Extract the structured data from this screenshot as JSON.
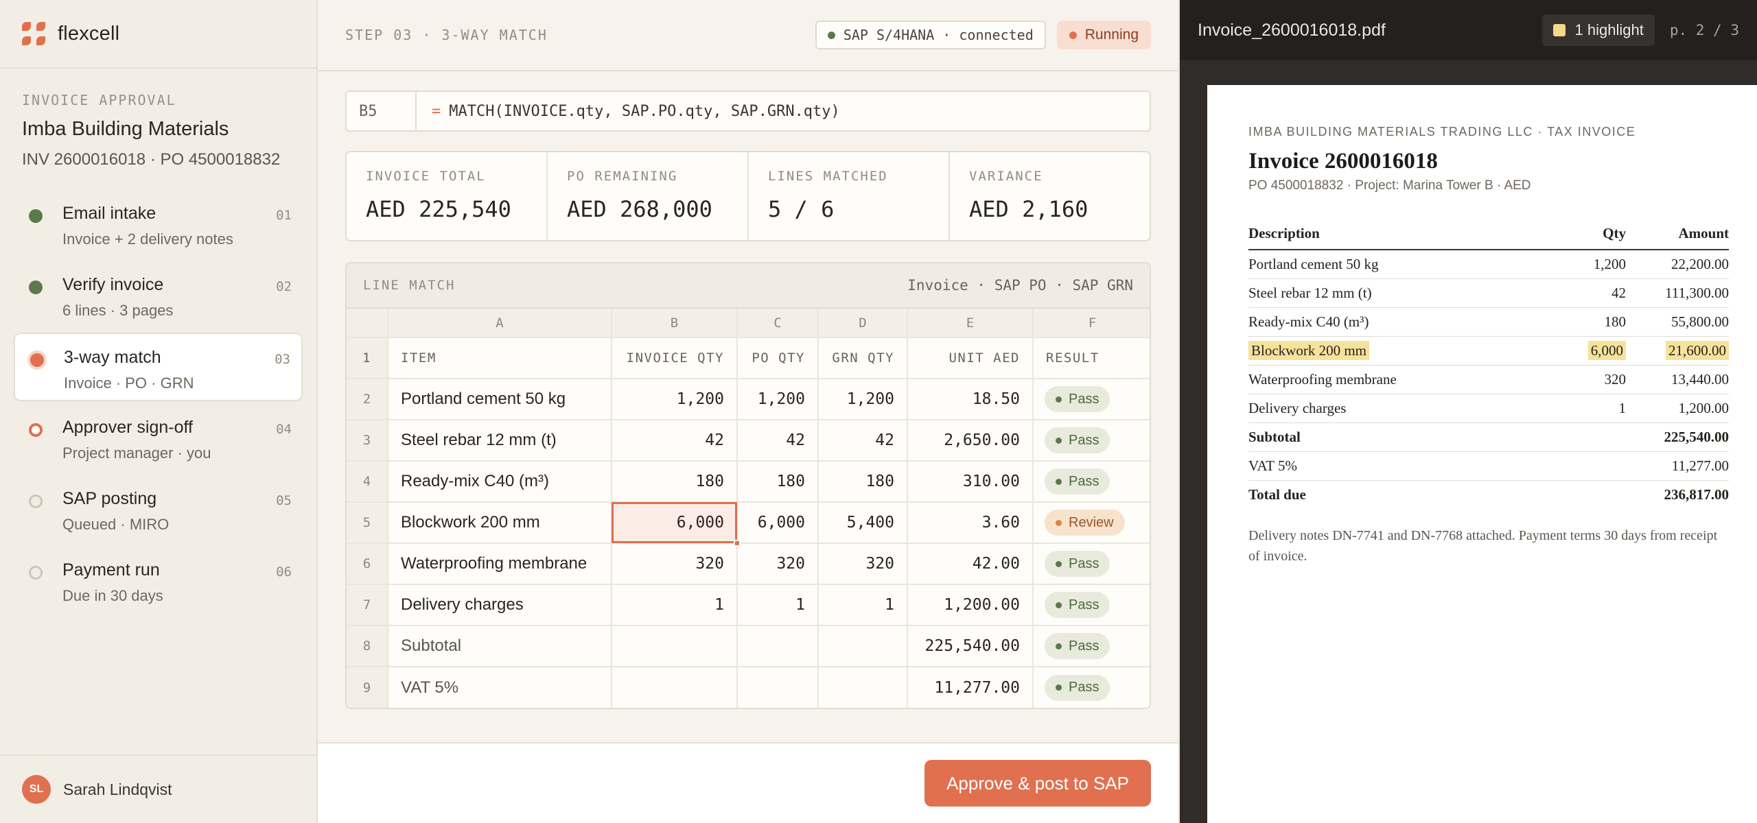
{
  "brand": {
    "name": "flexcell"
  },
  "invoice": {
    "eyebrow": "INVOICE APPROVAL",
    "vendor": "Imba Building Materials",
    "ids": "INV 2600016018 · PO 4500018832"
  },
  "steps": [
    {
      "title": "Email intake",
      "sub": "Invoice + 2 delivery notes",
      "num": "01",
      "status": "done"
    },
    {
      "title": "Verify invoice",
      "sub": "6 lines · 3 pages",
      "num": "02",
      "status": "done"
    },
    {
      "title": "3-way match",
      "sub": "Invoice · PO · GRN",
      "num": "03",
      "status": "active"
    },
    {
      "title": "Approver sign-off",
      "sub": "Project manager · you",
      "num": "04",
      "status": "next"
    },
    {
      "title": "SAP posting",
      "sub": "Queued · MIRO",
      "num": "05",
      "status": "pending"
    },
    {
      "title": "Payment run",
      "sub": "Due in 30 days",
      "num": "06",
      "status": "pending"
    }
  ],
  "user": {
    "initials": "SL",
    "name": "Sarah Lindqvist"
  },
  "topbar": {
    "step_label": "STEP 03 · 3-WAY MATCH",
    "connection": "SAP S/4HANA · connected",
    "status": "Running"
  },
  "formula": {
    "cell": "B5",
    "eq": "=",
    "expr": "MATCH(INVOICE.qty, SAP.PO.qty, SAP.GRN.qty)"
  },
  "kpis": [
    {
      "label": "INVOICE TOTAL",
      "value": "AED 225,540"
    },
    {
      "label": "PO REMAINING",
      "value": "AED 268,000"
    },
    {
      "label": "LINES MATCHED",
      "value": "5 / 6"
    },
    {
      "label": "VARIANCE",
      "value": "AED 2,160"
    }
  ],
  "grid": {
    "title": "LINE MATCH",
    "legend": "Invoice · SAP PO · SAP GRN",
    "columns": [
      "A",
      "B",
      "C",
      "D",
      "E",
      "F"
    ],
    "headers": [
      "ITEM",
      "INVOICE QTY",
      "PO QTY",
      "GRN QTY",
      "UNIT AED",
      "RESULT"
    ],
    "rows": [
      {
        "n": "2",
        "item": "Portland cement 50 kg",
        "inv": "1,200",
        "po": "1,200",
        "grn": "1,200",
        "unit": "18.50",
        "result": "Pass"
      },
      {
        "n": "3",
        "item": "Steel rebar 12 mm (t)",
        "inv": "42",
        "po": "42",
        "grn": "42",
        "unit": "2,650.00",
        "result": "Pass"
      },
      {
        "n": "4",
        "item": "Ready-mix C40 (m³)",
        "inv": "180",
        "po": "180",
        "grn": "180",
        "unit": "310.00",
        "result": "Pass"
      },
      {
        "n": "5",
        "item": "Blockwork 200 mm",
        "inv": "6,000",
        "po": "6,000",
        "grn": "5,400",
        "unit": "3.60",
        "result": "Review"
      },
      {
        "n": "6",
        "item": "Waterproofing membrane",
        "inv": "320",
        "po": "320",
        "grn": "320",
        "unit": "42.00",
        "result": "Pass"
      },
      {
        "n": "7",
        "item": "Delivery charges",
        "inv": "1",
        "po": "1",
        "grn": "1",
        "unit": "1,200.00",
        "result": "Pass"
      },
      {
        "n": "8",
        "item": "Subtotal",
        "inv": "",
        "po": "",
        "grn": "",
        "unit": "225,540.00",
        "result": "Pass"
      },
      {
        "n": "9",
        "item": "VAT 5%",
        "inv": "",
        "po": "",
        "grn": "",
        "unit": "11,277.00",
        "result": "Pass"
      }
    ]
  },
  "footer": {
    "approve_label": "Approve & post to SAP"
  },
  "viewer": {
    "filename": "Invoice_2600016018.pdf",
    "highlights": "1 highlight",
    "page": "p. 2 / 3",
    "doc": {
      "eyebrow": "IMBA BUILDING MATERIALS TRADING LLC · TAX INVOICE",
      "title": "Invoice 2600016018",
      "sub": "PO 4500018832 · Project: Marina Tower B · AED",
      "headers": [
        "Description",
        "Qty",
        "Amount"
      ],
      "lines": [
        {
          "desc": "Portland cement 50 kg",
          "qty": "1,200",
          "amount": "22,200.00"
        },
        {
          "desc": "Steel rebar 12 mm (t)",
          "qty": "42",
          "amount": "111,300.00"
        },
        {
          "desc": "Ready-mix C40 (m³)",
          "qty": "180",
          "amount": "55,800.00"
        },
        {
          "desc": "Blockwork 200 mm",
          "qty": "6,000",
          "amount": "21,600.00",
          "highlight": true
        },
        {
          "desc": "Waterproofing membrane",
          "qty": "320",
          "amount": "13,440.00"
        },
        {
          "desc": "Delivery charges",
          "qty": "1",
          "amount": "1,200.00"
        }
      ],
      "subtotal_label": "Subtotal",
      "subtotal": "225,540.00",
      "vat_label": "VAT 5%",
      "vat": "11,277.00",
      "total_label": "Total due",
      "total": "236,817.00",
      "note": "Delivery notes DN-7741 and DN-7768 attached. Payment terms 30 days from receipt of invoice."
    }
  },
  "colors": {
    "accent": "#e0704f",
    "pass": "#5b7a4a",
    "review": "#d98543",
    "highlight": "#f7e29b"
  }
}
